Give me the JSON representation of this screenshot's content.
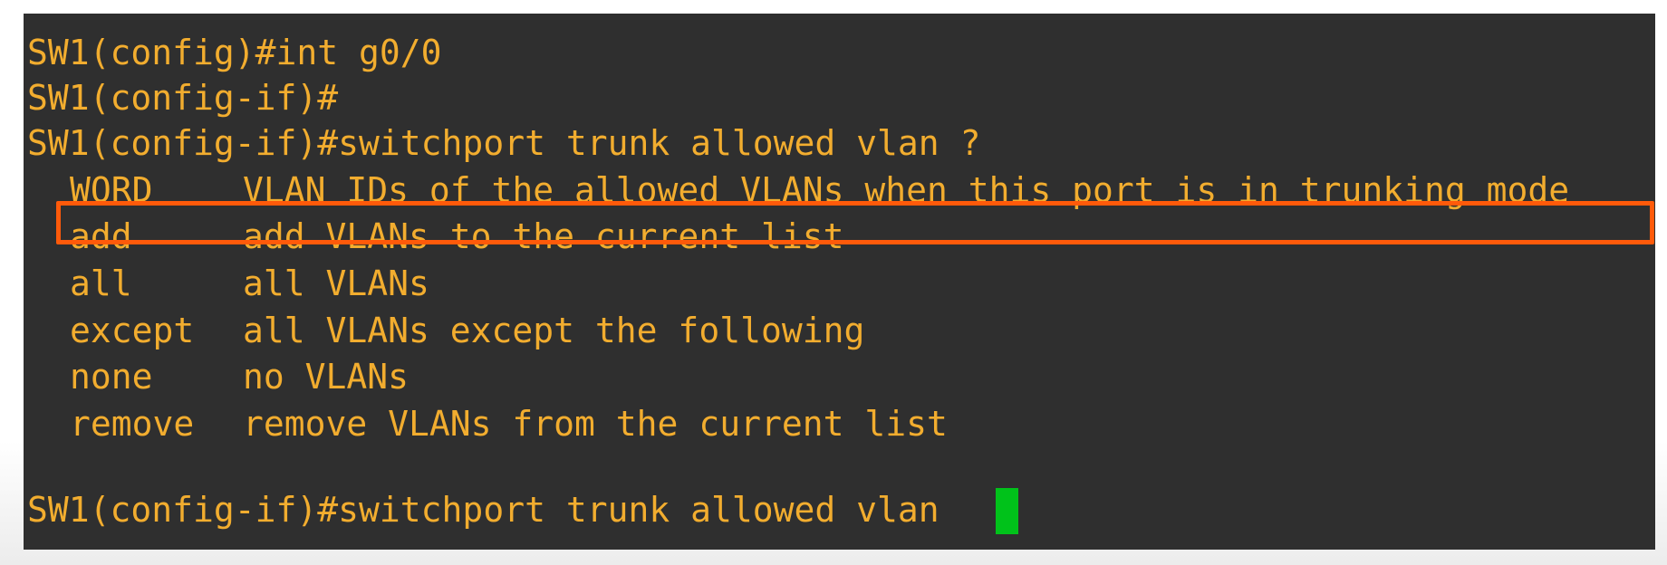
{
  "terminal": {
    "lines": [
      "SW1(config)#int g0/0",
      "SW1(config-if)#",
      "SW1(config-if)#switchport trunk allowed vlan ?"
    ],
    "options": [
      {
        "keyword": "WORD",
        "description": "VLAN IDs of the allowed VLANs when this port is in trunking mode"
      },
      {
        "keyword": "add",
        "description": "add VLANs to the current list"
      },
      {
        "keyword": "all",
        "description": "all VLANs"
      },
      {
        "keyword": "except",
        "description": "all VLANs except the following"
      },
      {
        "keyword": "none",
        "description": "no VLANs"
      },
      {
        "keyword": "remove",
        "description": "remove VLANs from the current list"
      }
    ],
    "prompt": "SW1(config-if)#switchport trunk allowed vlan "
  },
  "colors": {
    "background": "#2f2f2f",
    "text": "#f2ad2f",
    "highlight_border": "#ff5a0a",
    "cursor": "#00c21a"
  }
}
